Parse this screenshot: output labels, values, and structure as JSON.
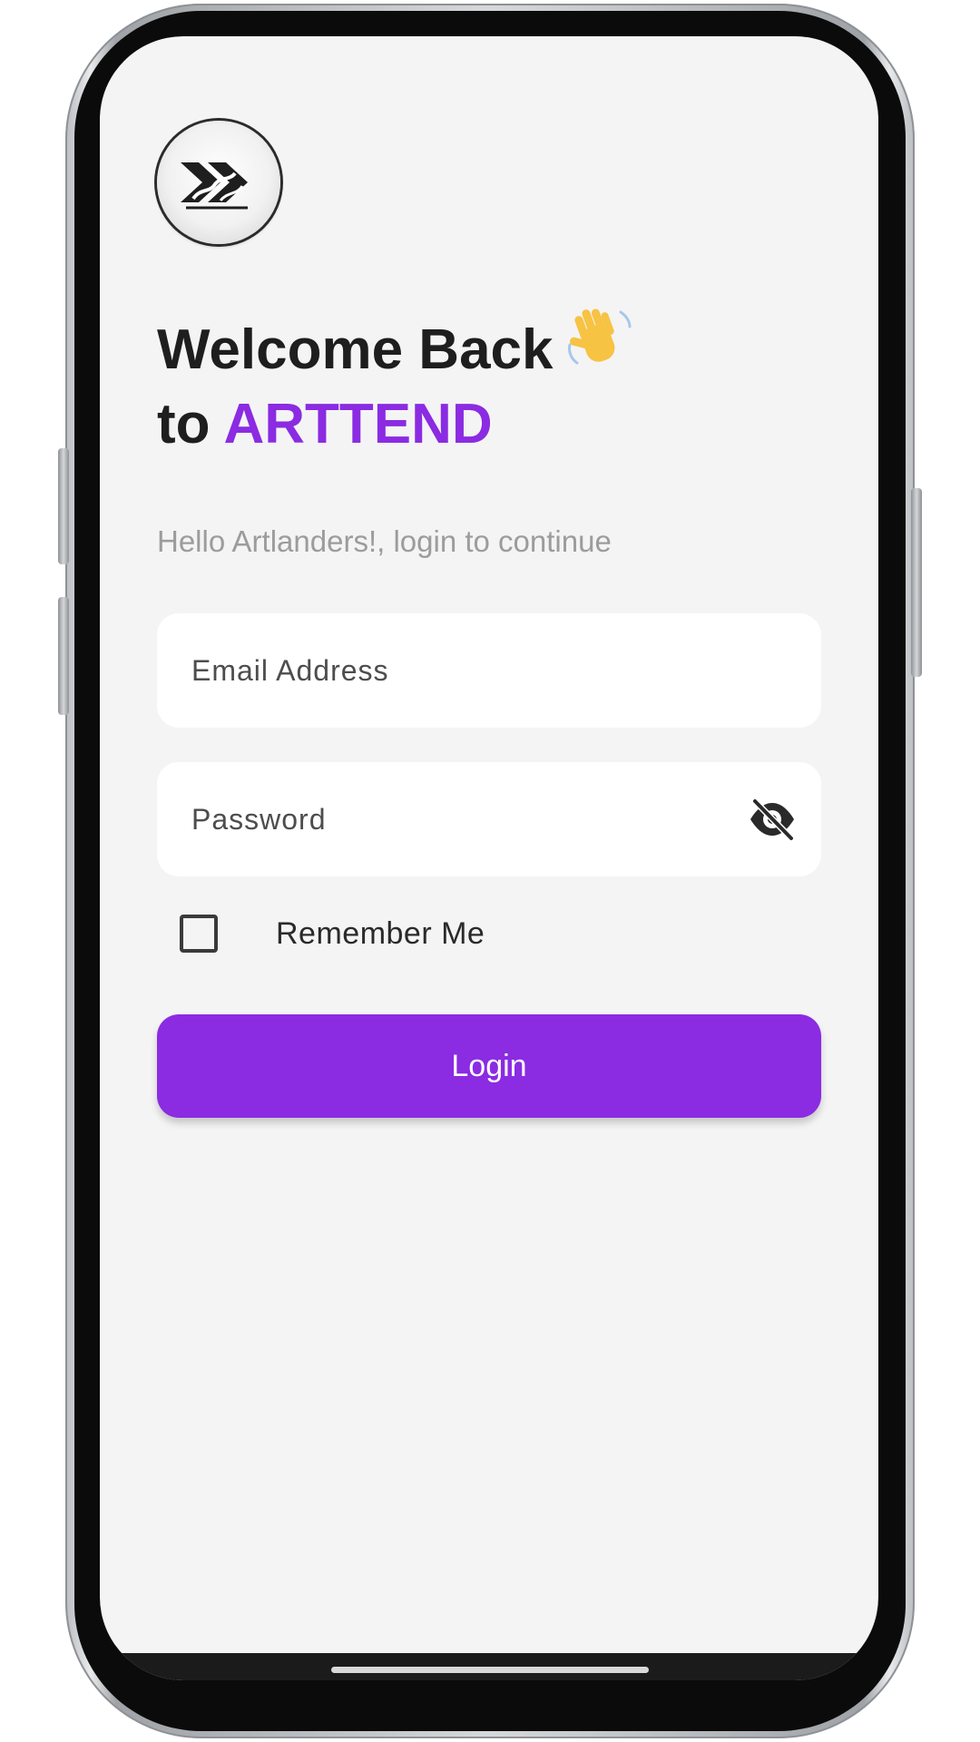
{
  "header": {
    "title_line1": "Welcome Back",
    "title_line2_prefix": "to",
    "title_brand": "ARTTEND",
    "subtitle": "Hello Artlanders!, login to continue"
  },
  "form": {
    "email_placeholder": "Email Address",
    "password_placeholder": "Password",
    "remember_label": "Remember Me",
    "remember_checked": false,
    "login_label": "Login"
  },
  "icons": {
    "logo": "double-chevron-logo-icon",
    "wave": "waving-hand-icon",
    "password_toggle": "eye-off-icon",
    "checkbox": "checkbox-unchecked-icon"
  },
  "colors": {
    "accent": "#8b2be2",
    "background": "#f4f4f5",
    "text_primary": "#1e1e1e",
    "text_muted": "#9c9c9c"
  }
}
